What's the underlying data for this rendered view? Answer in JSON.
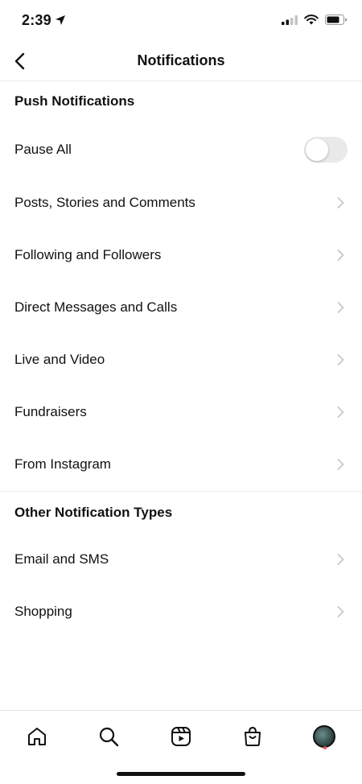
{
  "status": {
    "time": "2:39"
  },
  "header": {
    "title": "Notifications"
  },
  "sections": [
    {
      "title": "Push Notifications",
      "items": [
        {
          "label": "Pause All",
          "control": "toggle",
          "value": false
        },
        {
          "label": "Posts, Stories and Comments",
          "control": "chevron"
        },
        {
          "label": "Following and Followers",
          "control": "chevron"
        },
        {
          "label": "Direct Messages and Calls",
          "control": "chevron"
        },
        {
          "label": "Live and Video",
          "control": "chevron"
        },
        {
          "label": "Fundraisers",
          "control": "chevron"
        },
        {
          "label": "From Instagram",
          "control": "chevron"
        }
      ]
    },
    {
      "title": "Other Notification Types",
      "items": [
        {
          "label": "Email and SMS",
          "control": "chevron"
        },
        {
          "label": "Shopping",
          "control": "chevron"
        }
      ]
    }
  ],
  "tab_bar": {
    "items": [
      {
        "icon": "home-icon"
      },
      {
        "icon": "search-icon"
      },
      {
        "icon": "reels-icon"
      },
      {
        "icon": "shop-icon"
      },
      {
        "icon": "profile-avatar"
      }
    ]
  },
  "colors": {
    "toggle_off": "#e9e9eb",
    "badge": "#ed4956",
    "divider": "#ececec"
  }
}
